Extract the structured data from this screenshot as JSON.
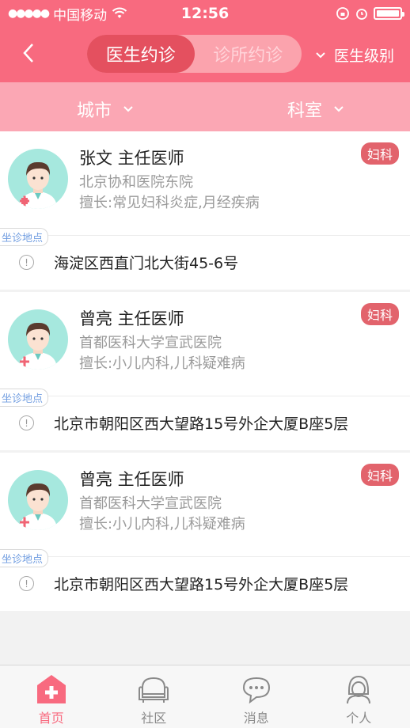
{
  "status_bar": {
    "carrier": "中国移动",
    "time": "12:56"
  },
  "nav": {
    "tabs": [
      "医生约诊",
      "诊所约诊"
    ],
    "level_filter": "医生级别"
  },
  "filters": {
    "city": "城市",
    "department": "科室"
  },
  "doctors": [
    {
      "name": "张文 主任医师",
      "hospital": "北京协和医院东院",
      "specialty": "擅长:常见妇科炎症,月经疾病",
      "department_badge": "妇科",
      "location_label": "坐诊地点",
      "address": "海淀区西直门北大街45-6号"
    },
    {
      "name": "曾亮 主任医师",
      "hospital": "首都医科大学宣武医院",
      "specialty": "擅长:小儿内科,儿科疑难病",
      "department_badge": "妇科",
      "location_label": "坐诊地点",
      "address": "北京市朝阳区西大望路15号外企大厦B座5层"
    },
    {
      "name": "曾亮 主任医师",
      "hospital": "首都医科大学宣武医院",
      "specialty": "擅长:小儿内科,儿科疑难病",
      "department_badge": "妇科",
      "location_label": "坐诊地点",
      "address": "北京市朝阳区西大望路15号外企大厦B座5层"
    }
  ],
  "tabbar": {
    "items": [
      {
        "label": "首页",
        "icon": "home-cross-icon"
      },
      {
        "label": "社区",
        "icon": "sofa-icon"
      },
      {
        "label": "消息",
        "icon": "chat-bubble-icon"
      },
      {
        "label": "个人",
        "icon": "person-icon"
      }
    ],
    "active_index": 0
  },
  "colors": {
    "primary": "#f86a7f",
    "filter_bg": "#fba7b4",
    "badge": "#e2636c",
    "avatar_bg": "#a6e8de",
    "location_tag_text": "#6f9ce0"
  }
}
